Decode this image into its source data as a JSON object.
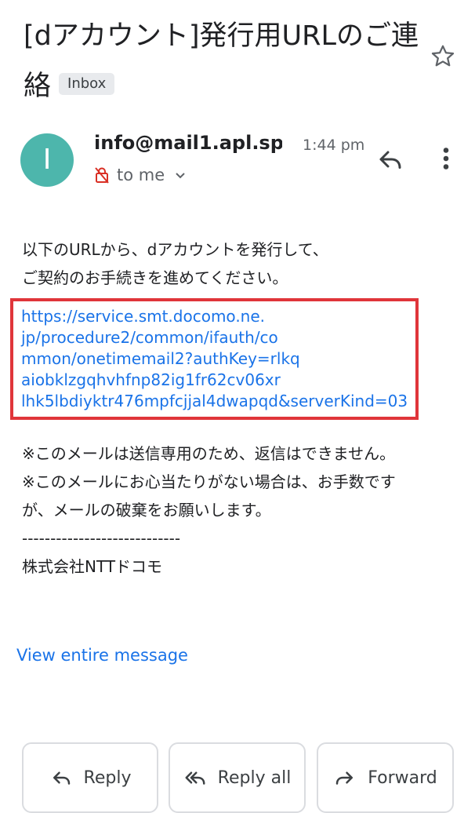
{
  "email": {
    "subject": "[dアカウント]発行用URLのご連絡",
    "label_badge": "Inbox",
    "sender": "info@mail1.apl.sp...",
    "avatar_letter": "I",
    "avatar_color": "#4db6ac",
    "time": "1:44 pm",
    "recipient": "to me",
    "body_intro": "以下のURLから、dアカウントを発行して、\nご契約のお手続きを進めてください。",
    "link": "https://service.smt.docomo.ne.\njp/procedure2/common/ifauth/co\nmmon/onetimemail2?authKey=rlkq\naiobklzgqhvhfnp82ig1fr62cv06xr\nlhk5lbdiyktr476mpfcjjal4dwapqd&serverKind=03",
    "body_notes": "※このメールは送信専用のため、返信はできません。\n※このメールにお心当たりがない場合は、お手数です\nが、メールの破棄をお願いします。\n----------------------------\n株式会社NTTドコモ",
    "view_entire": "View entire message"
  },
  "actions": {
    "reply": "Reply",
    "reply_all": "Reply all",
    "forward": "Forward"
  },
  "colors": {
    "link": "#1a73e8",
    "highlight_box": "#e0353a"
  }
}
